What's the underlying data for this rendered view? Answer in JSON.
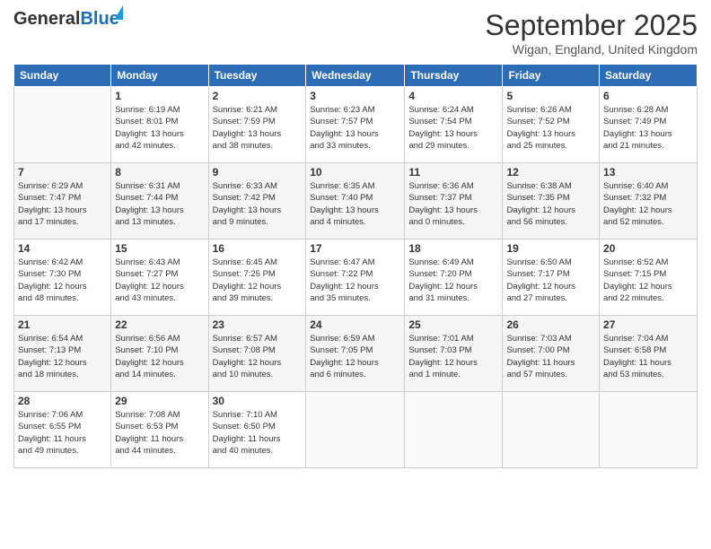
{
  "header": {
    "logo_general": "General",
    "logo_blue": "Blue",
    "month_title": "September 2025",
    "location": "Wigan, England, United Kingdom"
  },
  "weekdays": [
    "Sunday",
    "Monday",
    "Tuesday",
    "Wednesday",
    "Thursday",
    "Friday",
    "Saturday"
  ],
  "weeks": [
    [
      {
        "day": "",
        "info": ""
      },
      {
        "day": "1",
        "info": "Sunrise: 6:19 AM\nSunset: 8:01 PM\nDaylight: 13 hours\nand 42 minutes."
      },
      {
        "day": "2",
        "info": "Sunrise: 6:21 AM\nSunset: 7:59 PM\nDaylight: 13 hours\nand 38 minutes."
      },
      {
        "day": "3",
        "info": "Sunrise: 6:23 AM\nSunset: 7:57 PM\nDaylight: 13 hours\nand 33 minutes."
      },
      {
        "day": "4",
        "info": "Sunrise: 6:24 AM\nSunset: 7:54 PM\nDaylight: 13 hours\nand 29 minutes."
      },
      {
        "day": "5",
        "info": "Sunrise: 6:26 AM\nSunset: 7:52 PM\nDaylight: 13 hours\nand 25 minutes."
      },
      {
        "day": "6",
        "info": "Sunrise: 6:28 AM\nSunset: 7:49 PM\nDaylight: 13 hours\nand 21 minutes."
      }
    ],
    [
      {
        "day": "7",
        "info": "Sunrise: 6:29 AM\nSunset: 7:47 PM\nDaylight: 13 hours\nand 17 minutes."
      },
      {
        "day": "8",
        "info": "Sunrise: 6:31 AM\nSunset: 7:44 PM\nDaylight: 13 hours\nand 13 minutes."
      },
      {
        "day": "9",
        "info": "Sunrise: 6:33 AM\nSunset: 7:42 PM\nDaylight: 13 hours\nand 9 minutes."
      },
      {
        "day": "10",
        "info": "Sunrise: 6:35 AM\nSunset: 7:40 PM\nDaylight: 13 hours\nand 4 minutes."
      },
      {
        "day": "11",
        "info": "Sunrise: 6:36 AM\nSunset: 7:37 PM\nDaylight: 13 hours\nand 0 minutes."
      },
      {
        "day": "12",
        "info": "Sunrise: 6:38 AM\nSunset: 7:35 PM\nDaylight: 12 hours\nand 56 minutes."
      },
      {
        "day": "13",
        "info": "Sunrise: 6:40 AM\nSunset: 7:32 PM\nDaylight: 12 hours\nand 52 minutes."
      }
    ],
    [
      {
        "day": "14",
        "info": "Sunrise: 6:42 AM\nSunset: 7:30 PM\nDaylight: 12 hours\nand 48 minutes."
      },
      {
        "day": "15",
        "info": "Sunrise: 6:43 AM\nSunset: 7:27 PM\nDaylight: 12 hours\nand 43 minutes."
      },
      {
        "day": "16",
        "info": "Sunrise: 6:45 AM\nSunset: 7:25 PM\nDaylight: 12 hours\nand 39 minutes."
      },
      {
        "day": "17",
        "info": "Sunrise: 6:47 AM\nSunset: 7:22 PM\nDaylight: 12 hours\nand 35 minutes."
      },
      {
        "day": "18",
        "info": "Sunrise: 6:49 AM\nSunset: 7:20 PM\nDaylight: 12 hours\nand 31 minutes."
      },
      {
        "day": "19",
        "info": "Sunrise: 6:50 AM\nSunset: 7:17 PM\nDaylight: 12 hours\nand 27 minutes."
      },
      {
        "day": "20",
        "info": "Sunrise: 6:52 AM\nSunset: 7:15 PM\nDaylight: 12 hours\nand 22 minutes."
      }
    ],
    [
      {
        "day": "21",
        "info": "Sunrise: 6:54 AM\nSunset: 7:13 PM\nDaylight: 12 hours\nand 18 minutes."
      },
      {
        "day": "22",
        "info": "Sunrise: 6:56 AM\nSunset: 7:10 PM\nDaylight: 12 hours\nand 14 minutes."
      },
      {
        "day": "23",
        "info": "Sunrise: 6:57 AM\nSunset: 7:08 PM\nDaylight: 12 hours\nand 10 minutes."
      },
      {
        "day": "24",
        "info": "Sunrise: 6:59 AM\nSunset: 7:05 PM\nDaylight: 12 hours\nand 6 minutes."
      },
      {
        "day": "25",
        "info": "Sunrise: 7:01 AM\nSunset: 7:03 PM\nDaylight: 12 hours\nand 1 minute."
      },
      {
        "day": "26",
        "info": "Sunrise: 7:03 AM\nSunset: 7:00 PM\nDaylight: 11 hours\nand 57 minutes."
      },
      {
        "day": "27",
        "info": "Sunrise: 7:04 AM\nSunset: 6:58 PM\nDaylight: 11 hours\nand 53 minutes."
      }
    ],
    [
      {
        "day": "28",
        "info": "Sunrise: 7:06 AM\nSunset: 6:55 PM\nDaylight: 11 hours\nand 49 minutes."
      },
      {
        "day": "29",
        "info": "Sunrise: 7:08 AM\nSunset: 6:53 PM\nDaylight: 11 hours\nand 44 minutes."
      },
      {
        "day": "30",
        "info": "Sunrise: 7:10 AM\nSunset: 6:50 PM\nDaylight: 11 hours\nand 40 minutes."
      },
      {
        "day": "",
        "info": ""
      },
      {
        "day": "",
        "info": ""
      },
      {
        "day": "",
        "info": ""
      },
      {
        "day": "",
        "info": ""
      }
    ]
  ]
}
